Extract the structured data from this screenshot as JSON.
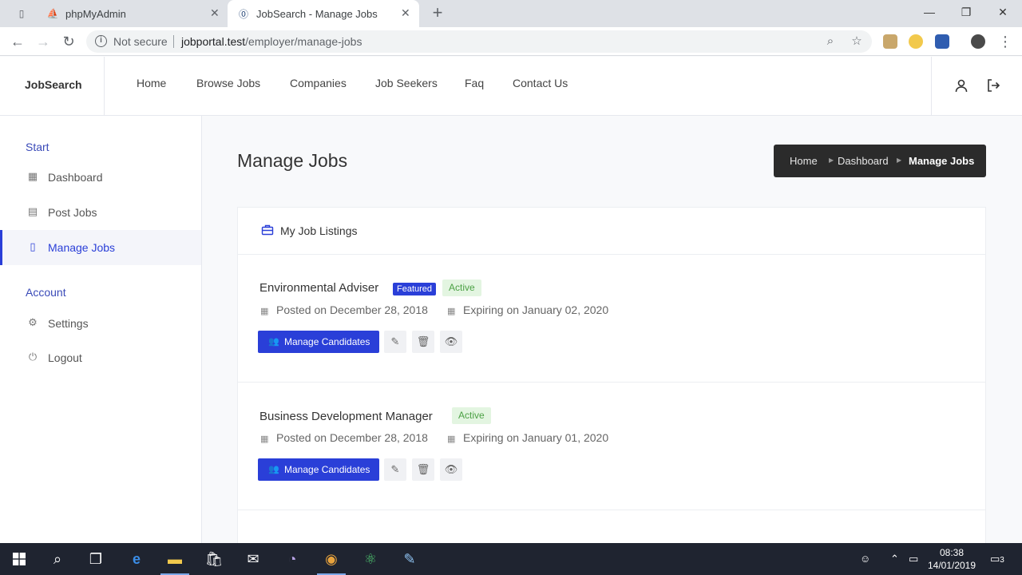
{
  "browser": {
    "tabs": [
      {
        "title": "phpMyAdmin",
        "active": false
      },
      {
        "title": "JobSearch - Manage Jobs",
        "active": true
      }
    ],
    "security_label": "Not secure",
    "url_host": "jobportal.test",
    "url_path": "/employer/manage-jobs"
  },
  "header": {
    "brand": "JobSearch",
    "nav": [
      "Home",
      "Browse Jobs",
      "Companies",
      "Job Seekers",
      "Faq",
      "Contact Us"
    ]
  },
  "sidebar": {
    "start_heading": "Start",
    "start_items": [
      {
        "label": "Dashboard",
        "icon": "dashboard-icon"
      },
      {
        "label": "Post Jobs",
        "icon": "clipboard-icon"
      },
      {
        "label": "Manage Jobs",
        "icon": "document-icon",
        "active": true
      }
    ],
    "account_heading": "Account",
    "account_items": [
      {
        "label": "Settings",
        "icon": "gear-icon"
      },
      {
        "label": "Logout",
        "icon": "power-icon"
      }
    ]
  },
  "main": {
    "title": "Manage Jobs",
    "breadcrumb": [
      "Home",
      "Dashboard",
      "Manage Jobs"
    ],
    "panel_title": "My Job Listings",
    "jobs": [
      {
        "title": "Environmental Adviser",
        "featured_label": "Featured",
        "status": "Active",
        "posted": "Posted on December 28, 2018",
        "expiring": "Expiring on January 02, 2020",
        "manage_label": "Manage Candidates"
      },
      {
        "title": "Business Development Manager",
        "status": "Active",
        "posted": "Posted on December 28, 2018",
        "expiring": "Expiring on January 01, 2020",
        "manage_label": "Manage Candidates"
      }
    ]
  },
  "taskbar": {
    "time": "08:38",
    "date": "14/01/2019",
    "notifications": "3"
  },
  "colors": {
    "accent": "#2a3fd8",
    "active_badge_bg": "#e3f5e1",
    "active_badge_text": "#4ca145",
    "breadcrumb_bg": "#2b2b2b"
  }
}
